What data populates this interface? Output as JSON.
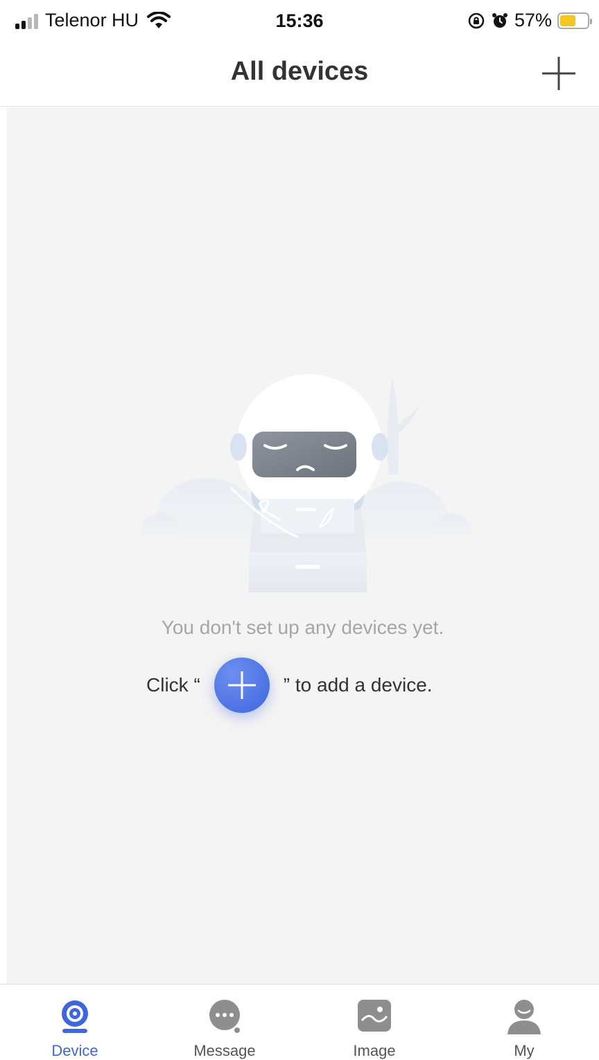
{
  "status_bar": {
    "carrier": "Telenor HU",
    "time": "15:36",
    "battery_percent": "57%",
    "battery_level": 0.57
  },
  "header": {
    "title": "All devices",
    "add_icon": "plus-icon"
  },
  "empty_state": {
    "message": "You don't set up any devices yet.",
    "hint_before": "Click “",
    "hint_after": "” to add a device.",
    "button_icon": "plus-icon"
  },
  "tabs": [
    {
      "label": "Device",
      "icon": "camera-icon",
      "active": true
    },
    {
      "label": "Message",
      "icon": "chat-icon",
      "active": false
    },
    {
      "label": "Image",
      "icon": "image-icon",
      "active": false
    },
    {
      "label": "My",
      "icon": "user-icon",
      "active": false
    }
  ],
  "colors": {
    "accent": "#3e66dd",
    "background": "#f4f4f4",
    "inactive_tab": "#8e8e8e",
    "battery": "#f5c623"
  }
}
